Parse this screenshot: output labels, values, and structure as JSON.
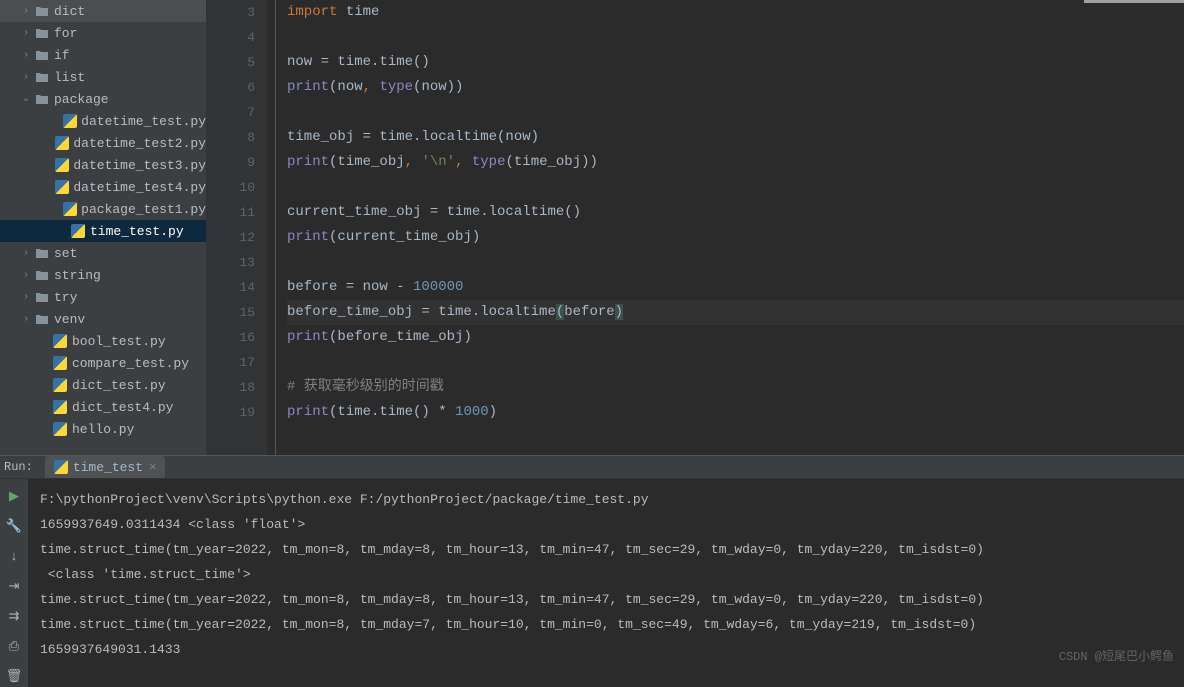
{
  "sidebar": {
    "items": [
      {
        "label": "dict",
        "type": "folder",
        "indent": 0,
        "chevron": "›"
      },
      {
        "label": "for",
        "type": "folder",
        "indent": 0,
        "chevron": "›"
      },
      {
        "label": "if",
        "type": "folder",
        "indent": 0,
        "chevron": "›"
      },
      {
        "label": "list",
        "type": "folder",
        "indent": 0,
        "chevron": "›"
      },
      {
        "label": "package",
        "type": "folder",
        "indent": 0,
        "chevron": "⌄",
        "expanded": true
      },
      {
        "label": "datetime_test.py",
        "type": "py",
        "indent": 2
      },
      {
        "label": "datetime_test2.py",
        "type": "py",
        "indent": 2
      },
      {
        "label": "datetime_test3.py",
        "type": "py",
        "indent": 2
      },
      {
        "label": "datetime_test4.py",
        "type": "py",
        "indent": 2
      },
      {
        "label": "package_test1.py",
        "type": "py",
        "indent": 2
      },
      {
        "label": "time_test.py",
        "type": "py",
        "indent": 2,
        "selected": true
      },
      {
        "label": "set",
        "type": "folder",
        "indent": 0,
        "chevron": "›"
      },
      {
        "label": "string",
        "type": "folder",
        "indent": 0,
        "chevron": "›"
      },
      {
        "label": "try",
        "type": "folder",
        "indent": 0,
        "chevron": "›"
      },
      {
        "label": "venv",
        "type": "folder",
        "indent": 0,
        "chevron": "›"
      },
      {
        "label": "bool_test.py",
        "type": "py",
        "indent": 1
      },
      {
        "label": "compare_test.py",
        "type": "py",
        "indent": 1
      },
      {
        "label": "dict_test.py",
        "type": "py",
        "indent": 1
      },
      {
        "label": "dict_test4.py",
        "type": "py",
        "indent": 1
      },
      {
        "label": "hello.py",
        "type": "py",
        "indent": 1
      }
    ]
  },
  "editor": {
    "lines": [
      {
        "num": 3,
        "tokens": [
          {
            "t": "import ",
            "c": "kw"
          },
          {
            "t": "time",
            "c": "default"
          }
        ]
      },
      {
        "num": 4,
        "tokens": []
      },
      {
        "num": 5,
        "tokens": [
          {
            "t": "now = time.time()",
            "c": "default"
          }
        ]
      },
      {
        "num": 6,
        "tokens": [
          {
            "t": "print",
            "c": "builtin"
          },
          {
            "t": "(now",
            "c": "default"
          },
          {
            "t": ", ",
            "c": "kw"
          },
          {
            "t": "type",
            "c": "builtin"
          },
          {
            "t": "(now))",
            "c": "default"
          }
        ]
      },
      {
        "num": 7,
        "tokens": []
      },
      {
        "num": 8,
        "tokens": [
          {
            "t": "time_obj = time.localtime(now)",
            "c": "default"
          }
        ]
      },
      {
        "num": 9,
        "tokens": [
          {
            "t": "print",
            "c": "builtin"
          },
          {
            "t": "(time_obj",
            "c": "default"
          },
          {
            "t": ", ",
            "c": "kw"
          },
          {
            "t": "'\\n'",
            "c": "str"
          },
          {
            "t": ", ",
            "c": "kw"
          },
          {
            "t": "type",
            "c": "builtin"
          },
          {
            "t": "(time_obj))",
            "c": "default"
          }
        ]
      },
      {
        "num": 10,
        "tokens": []
      },
      {
        "num": 11,
        "tokens": [
          {
            "t": "current_time_obj = time.localtime()",
            "c": "default"
          }
        ]
      },
      {
        "num": 12,
        "tokens": [
          {
            "t": "print",
            "c": "builtin"
          },
          {
            "t": "(current_time_obj)",
            "c": "default"
          }
        ]
      },
      {
        "num": 13,
        "tokens": []
      },
      {
        "num": 14,
        "tokens": [
          {
            "t": "before = now - ",
            "c": "default"
          },
          {
            "t": "100000",
            "c": "num"
          }
        ]
      },
      {
        "num": 15,
        "highlighted": true,
        "tokens": [
          {
            "t": "before_time_obj = time.localtime",
            "c": "default"
          },
          {
            "t": "(",
            "c": "paren-match"
          },
          {
            "t": "before",
            "c": "default"
          },
          {
            "t": ")",
            "c": "paren-match"
          }
        ]
      },
      {
        "num": 16,
        "tokens": [
          {
            "t": "print",
            "c": "builtin"
          },
          {
            "t": "(before_time_obj)",
            "c": "default"
          }
        ]
      },
      {
        "num": 17,
        "tokens": []
      },
      {
        "num": 18,
        "tokens": [
          {
            "t": "# 获取毫秒级别的时间戳",
            "c": "comment"
          }
        ]
      },
      {
        "num": 19,
        "tokens": [
          {
            "t": "print",
            "c": "builtin"
          },
          {
            "t": "(time.time() * ",
            "c": "default"
          },
          {
            "t": "1000",
            "c": "num"
          },
          {
            "t": ")",
            "c": "default"
          }
        ]
      }
    ]
  },
  "run": {
    "label": "Run:",
    "tab": "time_test",
    "output": [
      "F:\\pythonProject\\venv\\Scripts\\python.exe F:/pythonProject/package/time_test.py",
      "1659937649.0311434 <class 'float'>",
      "time.struct_time(tm_year=2022, tm_mon=8, tm_mday=8, tm_hour=13, tm_min=47, tm_sec=29, tm_wday=0, tm_yday=220, tm_isdst=0) ",
      " <class 'time.struct_time'>",
      "time.struct_time(tm_year=2022, tm_mon=8, tm_mday=8, tm_hour=13, tm_min=47, tm_sec=29, tm_wday=0, tm_yday=220, tm_isdst=0)",
      "time.struct_time(tm_year=2022, tm_mon=8, tm_mday=7, tm_hour=10, tm_min=0, tm_sec=49, tm_wday=6, tm_yday=219, tm_isdst=0)",
      "1659937649031.1433"
    ]
  },
  "watermark": "CSDN @短尾巴小鳄鱼"
}
